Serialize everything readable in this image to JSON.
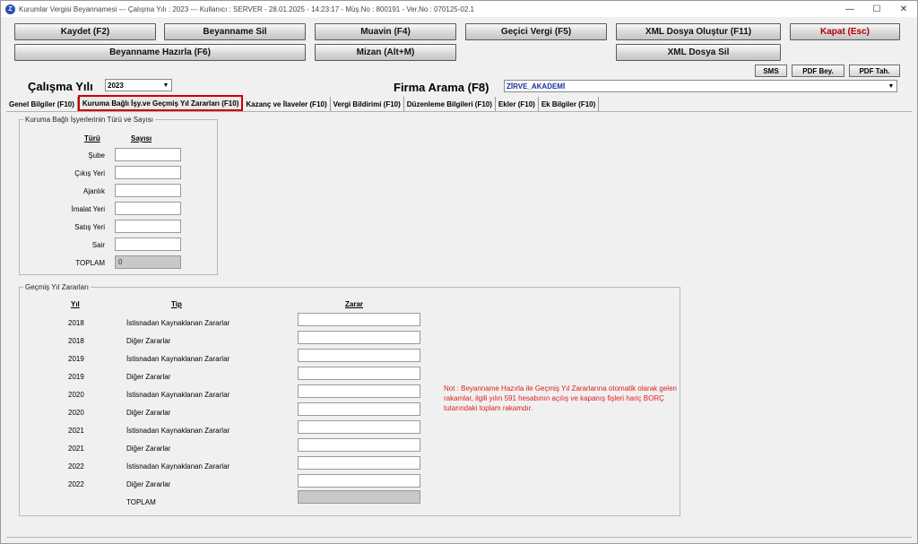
{
  "window": {
    "title": "Kurumlar Vergisi Beyannamesi  ---  Çalışma Yılı : 2023  ---  Kullanıcı : SERVER - 28.01.2025 - 14:23:17 - Müş.No : 800191 - Ver.No : 070125-02.1",
    "minimize": "—",
    "maximize": "☐",
    "close": "✕"
  },
  "toolbar": {
    "kaydet": "Kaydet (F2)",
    "beyanname_sil": "Beyanname Sil",
    "muavin": "Muavin (F4)",
    "gecici_vergi": "Geçici Vergi (F5)",
    "xml_olustur": "XML Dosya Oluştur (F11)",
    "kapat": "Kapat (Esc)",
    "beyanname_hazirla": "Beyanname Hazırla (F6)",
    "mizan": "Mizan (Alt+M)",
    "xml_sil": "XML Dosya Sil",
    "sms": "SMS",
    "pdf_bey": "PDF Bey.",
    "pdf_tah": "PDF Tah."
  },
  "filters": {
    "calisma_yili_label": "Çalışma Yılı",
    "calisma_yili_value": "2023",
    "firma_arama_label": "Firma Arama (F8)",
    "firma_value": "ZİRVE_AKADEMİ"
  },
  "tabs": [
    {
      "label": "Genel Bilgiler (F10)"
    },
    {
      "label": "Kuruma Bağlı İşy.ve Geçmiş Yıl Zararları (F10)",
      "active": true
    },
    {
      "label": "Kazanç ve İlaveler (F10)"
    },
    {
      "label": "Vergi Bildirimi (F10)"
    },
    {
      "label": "Düzenleme Bilgileri (F10)"
    },
    {
      "label": "Ekler (F10)"
    },
    {
      "label": "Ek Bilgiler (F10)"
    }
  ],
  "isyerleri": {
    "legend": "Kuruma Bağlı İşyerlerinin Türü ve Sayısı",
    "col_turu": "Türü",
    "col_sayisi": "Sayısı",
    "rows": [
      "Şube",
      "Çıkış Yeri",
      "Ajanlık",
      "İmalat Yeri",
      "Satış Yeri",
      "Sair"
    ],
    "toplam_label": "TOPLAM",
    "toplam_value": "0"
  },
  "zararlar": {
    "legend": "Geçmiş Yıl Zararları",
    "col_yil": "Yıl",
    "col_tip": "Tip",
    "col_zarar": "Zarar",
    "rows": [
      {
        "yil": "2018",
        "tip": "İstisnadan Kaynaklanan Zararlar"
      },
      {
        "yil": "2018",
        "tip": "Diğer Zararlar"
      },
      {
        "yil": "2019",
        "tip": "İstisnadan Kaynaklanan Zararlar"
      },
      {
        "yil": "2019",
        "tip": "Diğer Zararlar"
      },
      {
        "yil": "2020",
        "tip": "İstisnadan Kaynaklanan Zararlar"
      },
      {
        "yil": "2020",
        "tip": "Diğer Zararlar"
      },
      {
        "yil": "2021",
        "tip": "İstisnadan Kaynaklanan Zararlar"
      },
      {
        "yil": "2021",
        "tip": "Diğer Zararlar"
      },
      {
        "yil": "2022",
        "tip": "İstisnadan Kaynaklanan Zararlar"
      },
      {
        "yil": "2022",
        "tip": "Diğer Zararlar"
      }
    ],
    "toplam_label": "TOPLAM",
    "note": "Not : Beyanname Hazırla ile Geçmiş Yıl Zararlarına otomatik olarak gelen rakamlar, ilgili yılın 591 hesabının açılış ve kapanış fişleri hariç BORÇ tutarındaki toplam rakamdır."
  },
  "colors": {
    "accent_red": "#d00000",
    "note_red": "#e02020",
    "firma_blue": "#1a2fa0"
  }
}
